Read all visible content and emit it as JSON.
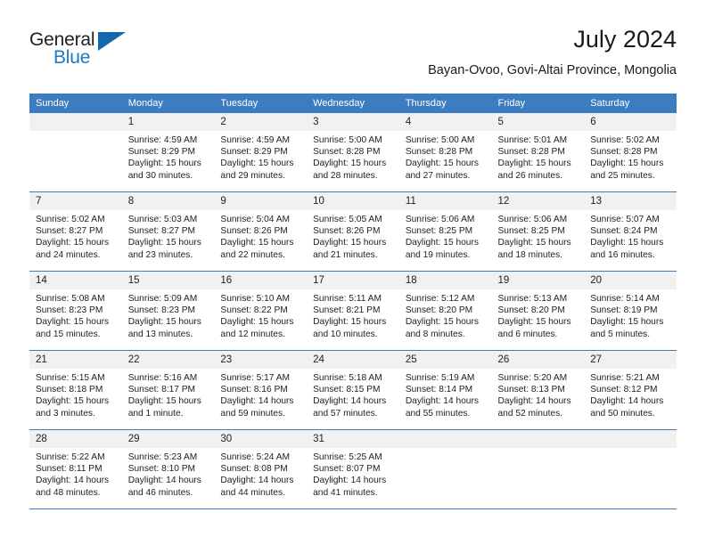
{
  "brand": {
    "name_part1": "General",
    "name_part2": "Blue",
    "triangle_icon": "triangle-icon",
    "colors": {
      "dark": "#231f20",
      "blue": "#1b7ac4",
      "triangle": "#1567ae"
    }
  },
  "header": {
    "title": "July 2024",
    "subtitle": "Bayan-Ovoo, Govi-Altai Province, Mongolia"
  },
  "theme": {
    "header_blue": "#3b7dc0",
    "daynum_gray": "#f1f1f1",
    "text": "#222222"
  },
  "weekday_headers": [
    "Sunday",
    "Monday",
    "Tuesday",
    "Wednesday",
    "Thursday",
    "Friday",
    "Saturday"
  ],
  "weeks": [
    [
      {
        "day": "",
        "sunrise": "",
        "sunset": "",
        "daylight_line1": "",
        "daylight_line2": ""
      },
      {
        "day": "1",
        "sunrise": "Sunrise: 4:59 AM",
        "sunset": "Sunset: 8:29 PM",
        "daylight_line1": "Daylight: 15 hours",
        "daylight_line2": "and 30 minutes."
      },
      {
        "day": "2",
        "sunrise": "Sunrise: 4:59 AM",
        "sunset": "Sunset: 8:29 PM",
        "daylight_line1": "Daylight: 15 hours",
        "daylight_line2": "and 29 minutes."
      },
      {
        "day": "3",
        "sunrise": "Sunrise: 5:00 AM",
        "sunset": "Sunset: 8:28 PM",
        "daylight_line1": "Daylight: 15 hours",
        "daylight_line2": "and 28 minutes."
      },
      {
        "day": "4",
        "sunrise": "Sunrise: 5:00 AM",
        "sunset": "Sunset: 8:28 PM",
        "daylight_line1": "Daylight: 15 hours",
        "daylight_line2": "and 27 minutes."
      },
      {
        "day": "5",
        "sunrise": "Sunrise: 5:01 AM",
        "sunset": "Sunset: 8:28 PM",
        "daylight_line1": "Daylight: 15 hours",
        "daylight_line2": "and 26 minutes."
      },
      {
        "day": "6",
        "sunrise": "Sunrise: 5:02 AM",
        "sunset": "Sunset: 8:28 PM",
        "daylight_line1": "Daylight: 15 hours",
        "daylight_line2": "and 25 minutes."
      }
    ],
    [
      {
        "day": "7",
        "sunrise": "Sunrise: 5:02 AM",
        "sunset": "Sunset: 8:27 PM",
        "daylight_line1": "Daylight: 15 hours",
        "daylight_line2": "and 24 minutes."
      },
      {
        "day": "8",
        "sunrise": "Sunrise: 5:03 AM",
        "sunset": "Sunset: 8:27 PM",
        "daylight_line1": "Daylight: 15 hours",
        "daylight_line2": "and 23 minutes."
      },
      {
        "day": "9",
        "sunrise": "Sunrise: 5:04 AM",
        "sunset": "Sunset: 8:26 PM",
        "daylight_line1": "Daylight: 15 hours",
        "daylight_line2": "and 22 minutes."
      },
      {
        "day": "10",
        "sunrise": "Sunrise: 5:05 AM",
        "sunset": "Sunset: 8:26 PM",
        "daylight_line1": "Daylight: 15 hours",
        "daylight_line2": "and 21 minutes."
      },
      {
        "day": "11",
        "sunrise": "Sunrise: 5:06 AM",
        "sunset": "Sunset: 8:25 PM",
        "daylight_line1": "Daylight: 15 hours",
        "daylight_line2": "and 19 minutes."
      },
      {
        "day": "12",
        "sunrise": "Sunrise: 5:06 AM",
        "sunset": "Sunset: 8:25 PM",
        "daylight_line1": "Daylight: 15 hours",
        "daylight_line2": "and 18 minutes."
      },
      {
        "day": "13",
        "sunrise": "Sunrise: 5:07 AM",
        "sunset": "Sunset: 8:24 PM",
        "daylight_line1": "Daylight: 15 hours",
        "daylight_line2": "and 16 minutes."
      }
    ],
    [
      {
        "day": "14",
        "sunrise": "Sunrise: 5:08 AM",
        "sunset": "Sunset: 8:23 PM",
        "daylight_line1": "Daylight: 15 hours",
        "daylight_line2": "and 15 minutes."
      },
      {
        "day": "15",
        "sunrise": "Sunrise: 5:09 AM",
        "sunset": "Sunset: 8:23 PM",
        "daylight_line1": "Daylight: 15 hours",
        "daylight_line2": "and 13 minutes."
      },
      {
        "day": "16",
        "sunrise": "Sunrise: 5:10 AM",
        "sunset": "Sunset: 8:22 PM",
        "daylight_line1": "Daylight: 15 hours",
        "daylight_line2": "and 12 minutes."
      },
      {
        "day": "17",
        "sunrise": "Sunrise: 5:11 AM",
        "sunset": "Sunset: 8:21 PM",
        "daylight_line1": "Daylight: 15 hours",
        "daylight_line2": "and 10 minutes."
      },
      {
        "day": "18",
        "sunrise": "Sunrise: 5:12 AM",
        "sunset": "Sunset: 8:20 PM",
        "daylight_line1": "Daylight: 15 hours",
        "daylight_line2": "and 8 minutes."
      },
      {
        "day": "19",
        "sunrise": "Sunrise: 5:13 AM",
        "sunset": "Sunset: 8:20 PM",
        "daylight_line1": "Daylight: 15 hours",
        "daylight_line2": "and 6 minutes."
      },
      {
        "day": "20",
        "sunrise": "Sunrise: 5:14 AM",
        "sunset": "Sunset: 8:19 PM",
        "daylight_line1": "Daylight: 15 hours",
        "daylight_line2": "and 5 minutes."
      }
    ],
    [
      {
        "day": "21",
        "sunrise": "Sunrise: 5:15 AM",
        "sunset": "Sunset: 8:18 PM",
        "daylight_line1": "Daylight: 15 hours",
        "daylight_line2": "and 3 minutes."
      },
      {
        "day": "22",
        "sunrise": "Sunrise: 5:16 AM",
        "sunset": "Sunset: 8:17 PM",
        "daylight_line1": "Daylight: 15 hours",
        "daylight_line2": "and 1 minute."
      },
      {
        "day": "23",
        "sunrise": "Sunrise: 5:17 AM",
        "sunset": "Sunset: 8:16 PM",
        "daylight_line1": "Daylight: 14 hours",
        "daylight_line2": "and 59 minutes."
      },
      {
        "day": "24",
        "sunrise": "Sunrise: 5:18 AM",
        "sunset": "Sunset: 8:15 PM",
        "daylight_line1": "Daylight: 14 hours",
        "daylight_line2": "and 57 minutes."
      },
      {
        "day": "25",
        "sunrise": "Sunrise: 5:19 AM",
        "sunset": "Sunset: 8:14 PM",
        "daylight_line1": "Daylight: 14 hours",
        "daylight_line2": "and 55 minutes."
      },
      {
        "day": "26",
        "sunrise": "Sunrise: 5:20 AM",
        "sunset": "Sunset: 8:13 PM",
        "daylight_line1": "Daylight: 14 hours",
        "daylight_line2": "and 52 minutes."
      },
      {
        "day": "27",
        "sunrise": "Sunrise: 5:21 AM",
        "sunset": "Sunset: 8:12 PM",
        "daylight_line1": "Daylight: 14 hours",
        "daylight_line2": "and 50 minutes."
      }
    ],
    [
      {
        "day": "28",
        "sunrise": "Sunrise: 5:22 AM",
        "sunset": "Sunset: 8:11 PM",
        "daylight_line1": "Daylight: 14 hours",
        "daylight_line2": "and 48 minutes."
      },
      {
        "day": "29",
        "sunrise": "Sunrise: 5:23 AM",
        "sunset": "Sunset: 8:10 PM",
        "daylight_line1": "Daylight: 14 hours",
        "daylight_line2": "and 46 minutes."
      },
      {
        "day": "30",
        "sunrise": "Sunrise: 5:24 AM",
        "sunset": "Sunset: 8:08 PM",
        "daylight_line1": "Daylight: 14 hours",
        "daylight_line2": "and 44 minutes."
      },
      {
        "day": "31",
        "sunrise": "Sunrise: 5:25 AM",
        "sunset": "Sunset: 8:07 PM",
        "daylight_line1": "Daylight: 14 hours",
        "daylight_line2": "and 41 minutes."
      },
      {
        "day": "",
        "sunrise": "",
        "sunset": "",
        "daylight_line1": "",
        "daylight_line2": ""
      },
      {
        "day": "",
        "sunrise": "",
        "sunset": "",
        "daylight_line1": "",
        "daylight_line2": ""
      },
      {
        "day": "",
        "sunrise": "",
        "sunset": "",
        "daylight_line1": "",
        "daylight_line2": ""
      }
    ]
  ]
}
